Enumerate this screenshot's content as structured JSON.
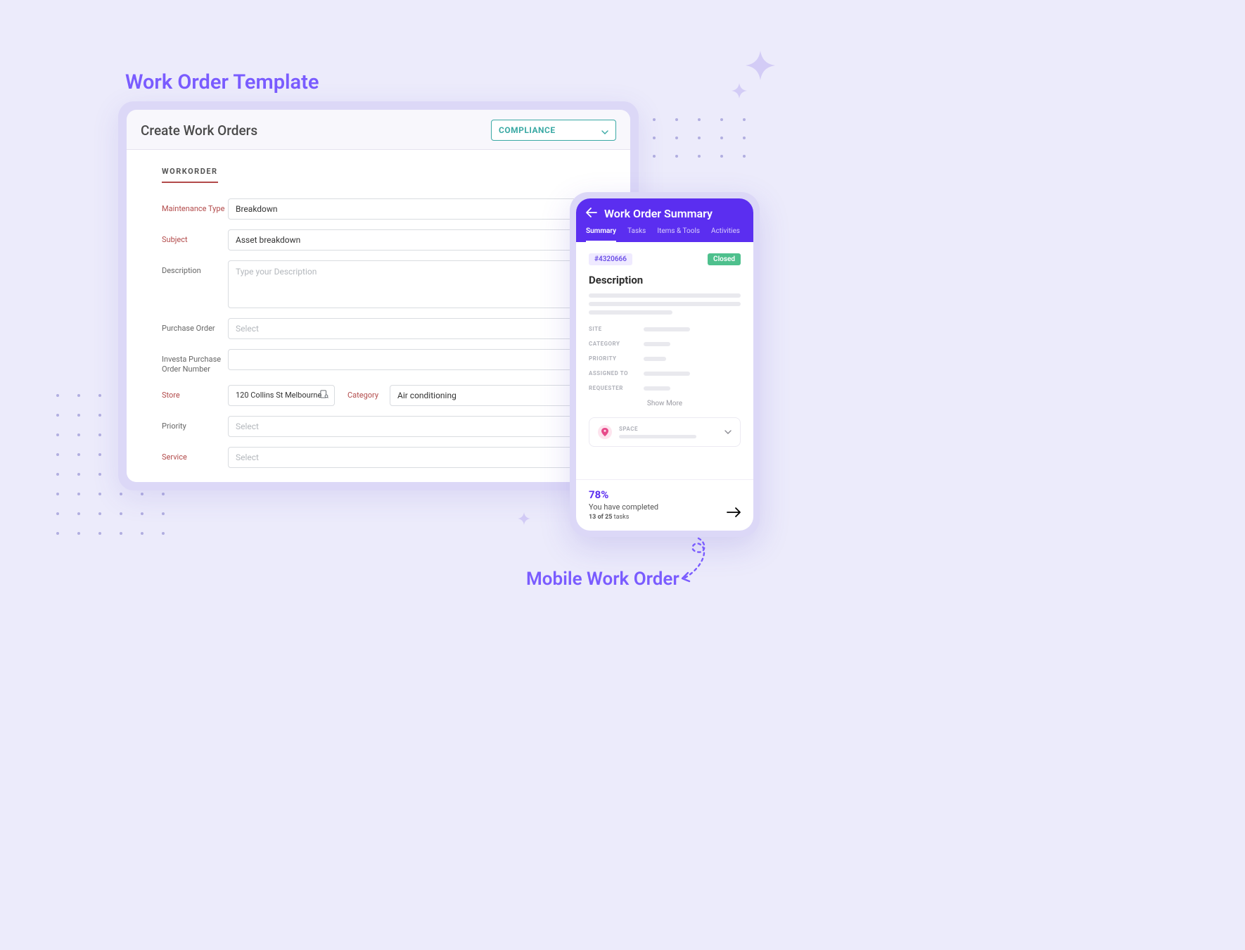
{
  "titles": {
    "top": "Work Order Template",
    "bottom": "Mobile Work Order"
  },
  "desktop": {
    "header_title": "Create Work Orders",
    "compliance_label": "COMPLIANCE",
    "tab_label": "WORKORDER",
    "fields": {
      "maintenance_type": {
        "label": "Maintenance Type",
        "value": "Breakdown"
      },
      "subject": {
        "label": "Subject",
        "value": "Asset breakdown"
      },
      "description": {
        "label": "Description",
        "placeholder": "Type your  Description"
      },
      "purchase_order": {
        "label": "Purchase Order",
        "placeholder": "Select"
      },
      "investa_po": {
        "label": "Investa Purchase Order Number",
        "value": ""
      },
      "store": {
        "label": "Store",
        "value": "120 Collins St Melbourne"
      },
      "category": {
        "label": "Category",
        "value": "Air conditioning"
      },
      "priority": {
        "label": "Priority",
        "placeholder": "Select"
      },
      "service": {
        "label": "Service",
        "placeholder": "Select"
      }
    }
  },
  "mobile": {
    "title": "Work Order Summary",
    "tabs": [
      "Summary",
      "Tasks",
      "Items & Tools",
      "Activities"
    ],
    "active_tab": "Summary",
    "id": "#4320666",
    "status": "Closed",
    "section_title": "Description",
    "meta_labels": [
      "SITE",
      "CATEGORY",
      "PRIORITY",
      "ASSIGNED TO",
      "REQUESTER"
    ],
    "show_more": "Show More",
    "space_label": "SPACE",
    "progress": {
      "percent": "78%",
      "line1": "You have completed",
      "count": "13 of 25",
      "unit": "tasks"
    }
  }
}
